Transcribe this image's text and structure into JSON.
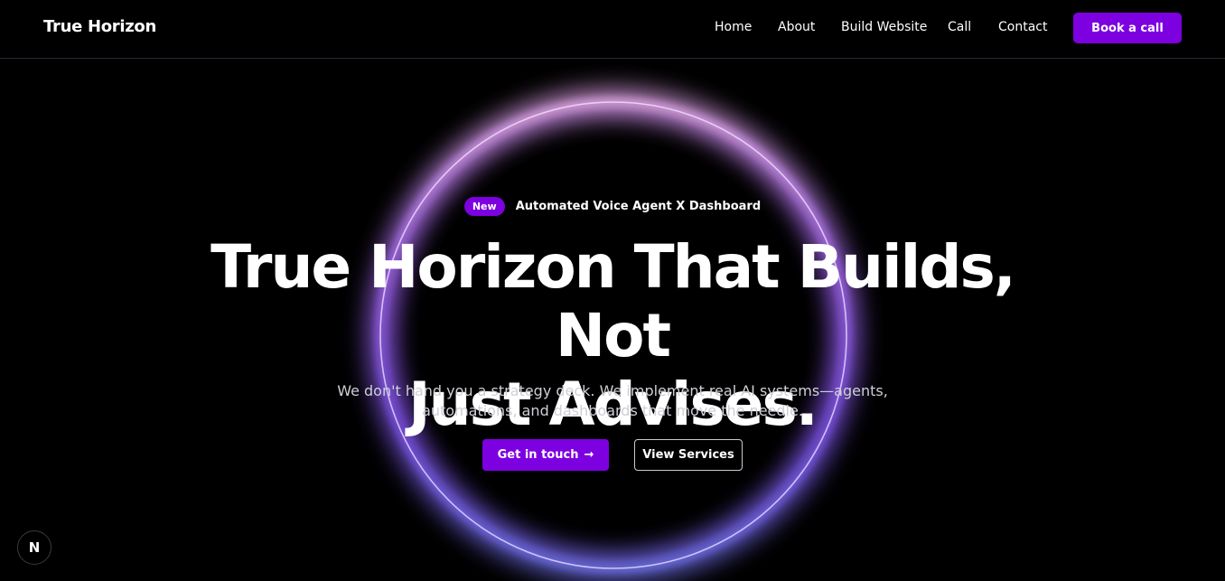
{
  "header": {
    "brand": "True Horizon",
    "nav": [
      {
        "label": "Home"
      },
      {
        "label": "About"
      },
      {
        "label": "Build Website"
      },
      {
        "label": "Call"
      },
      {
        "label": "Contact"
      }
    ],
    "cta_label": "Book a call"
  },
  "hero": {
    "badge_label": "New",
    "badge_text": "Automated Voice Agent X Dashboard",
    "headline_line1": "True Horizon That Builds, Not",
    "headline_line2": "Just Advises.",
    "subtitle_line1": "We don't hand you a strategy deck. We implement real AI systems—agents,",
    "subtitle_line2": "automations, and dashboards that move the needle.",
    "primary_button": "Get in touch",
    "primary_button_icon": "→",
    "secondary_button": "View Services"
  },
  "corner_badge": "N",
  "colors": {
    "accent": "#7d00e0",
    "background": "#000000",
    "ring_top": "#f0a8ff",
    "ring_bottom": "#7b6cff"
  }
}
